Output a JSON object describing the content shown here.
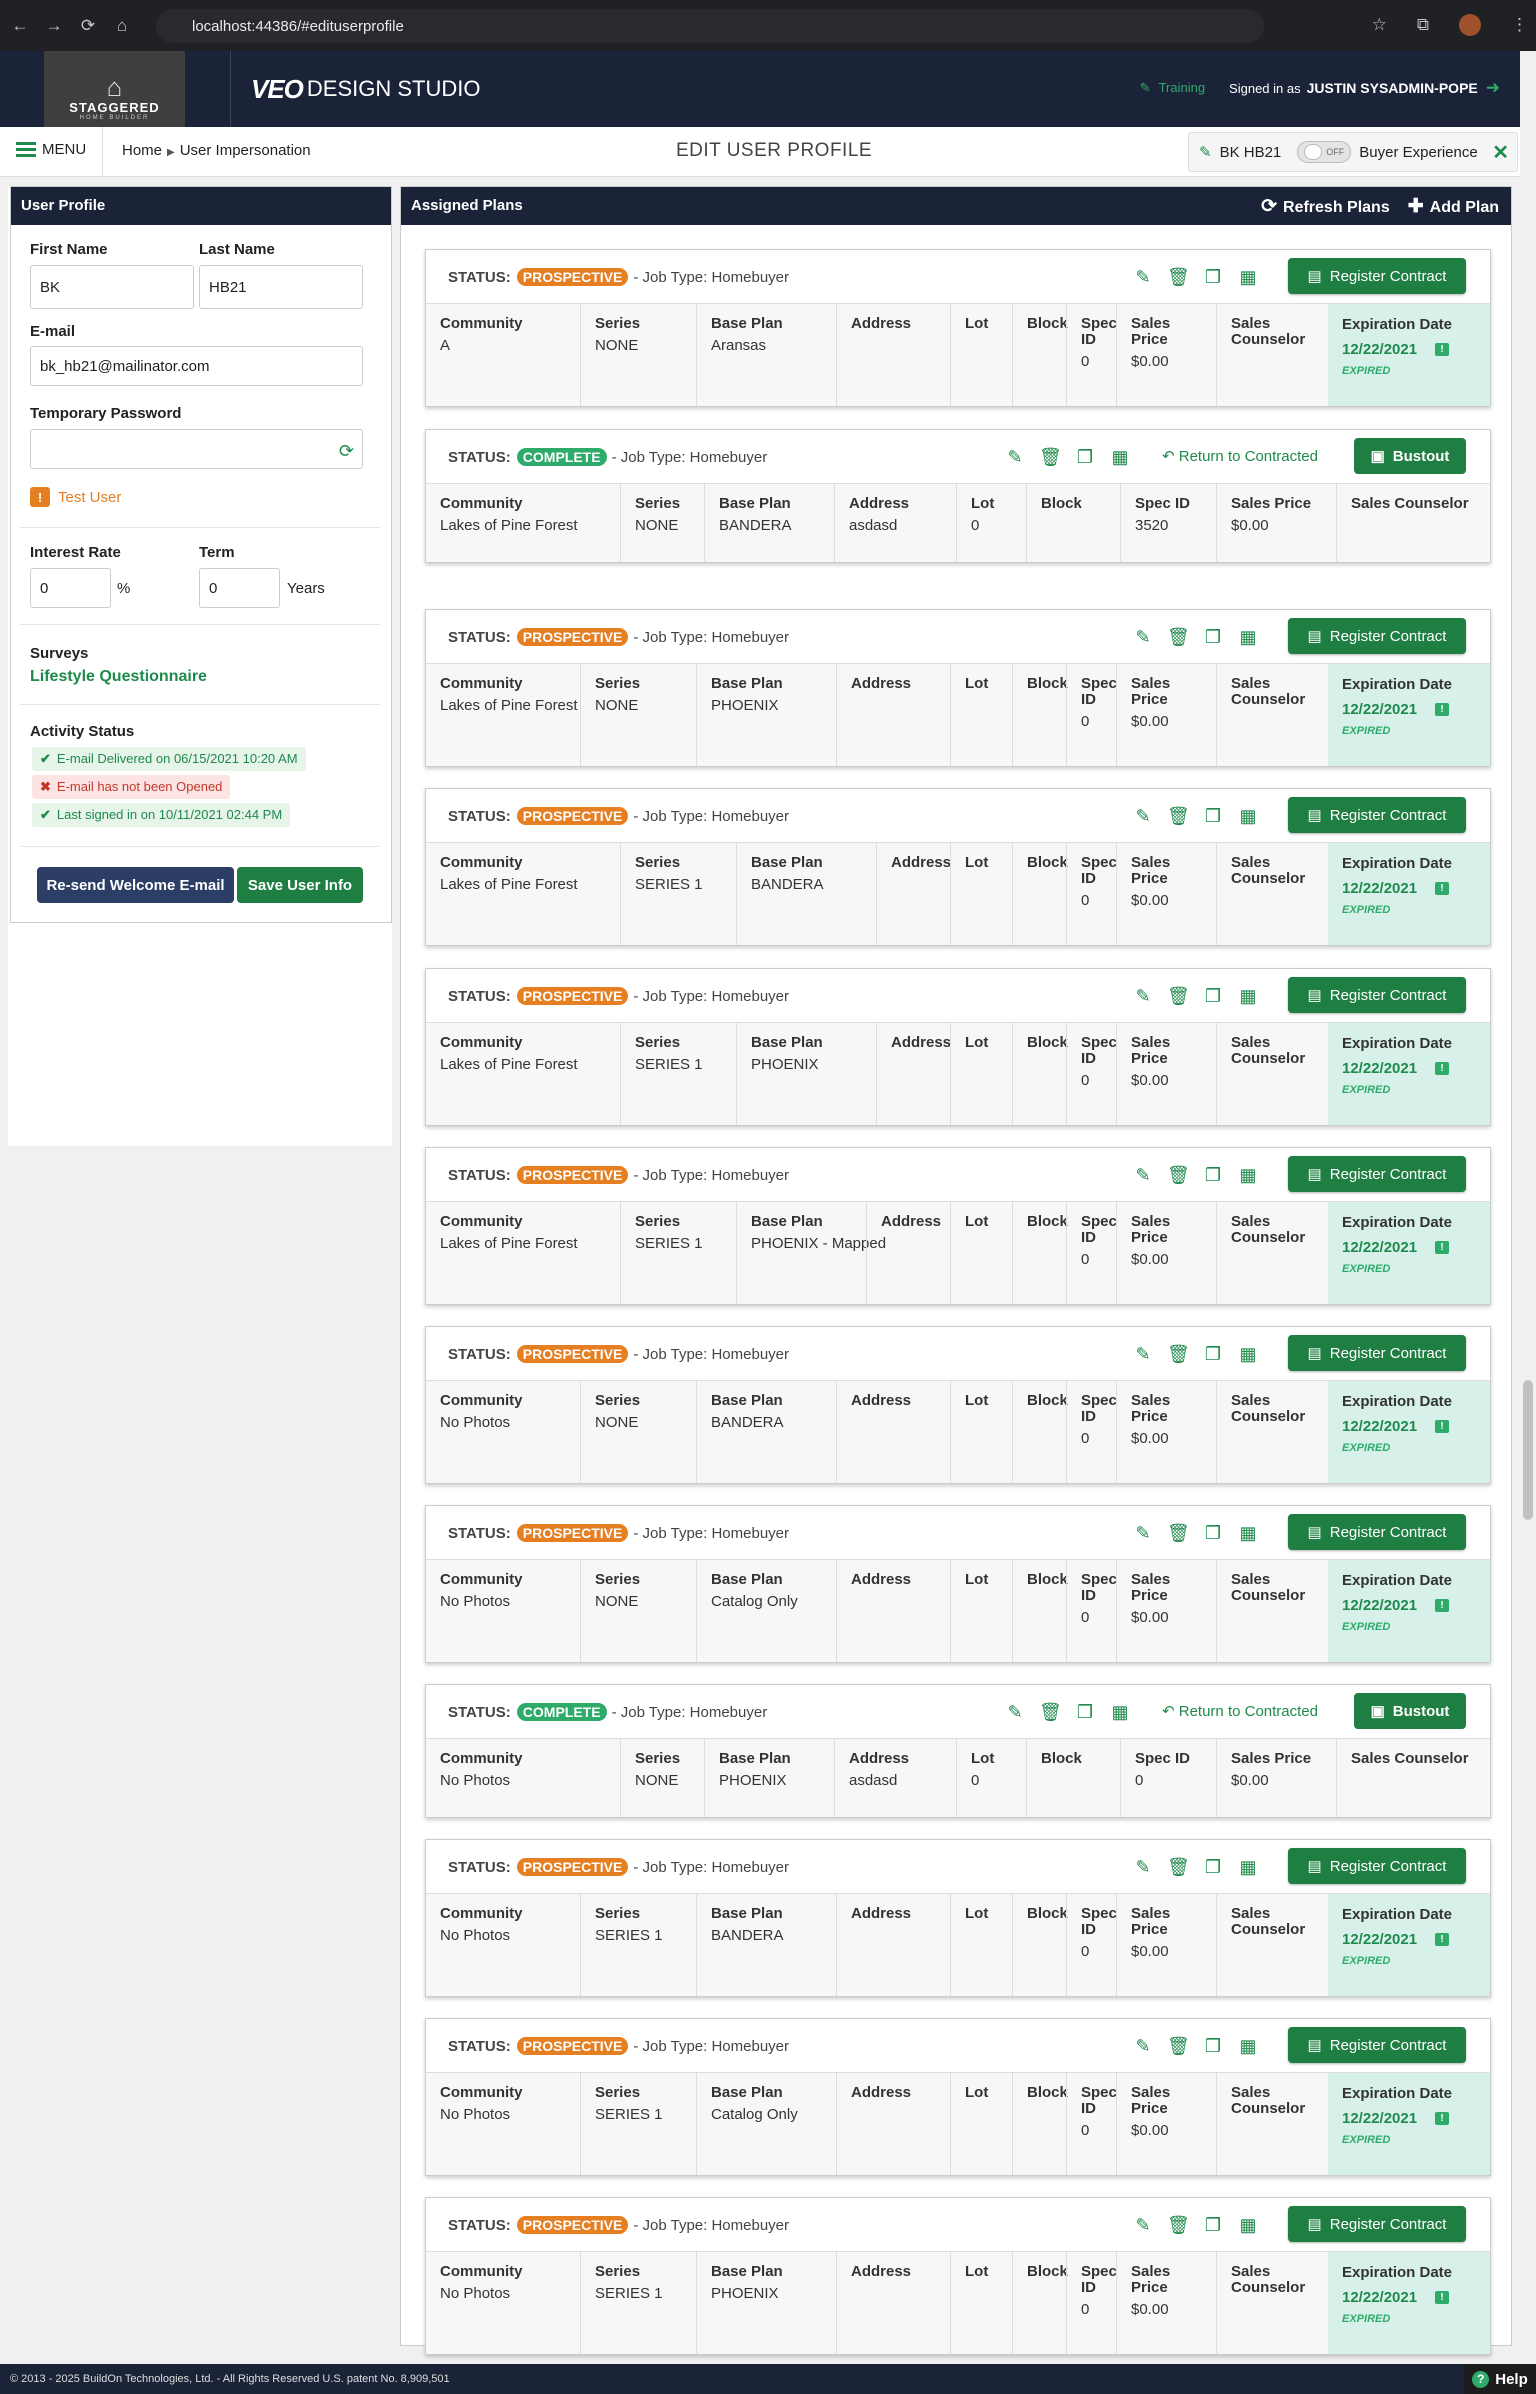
{
  "browser": {
    "url": "localhost:44386/#edituserprofile"
  },
  "brand": {
    "logo_line1": "STAGGERED",
    "logo_line2": "HOME BUILDER",
    "product_main": "VEO",
    "product_sub": "DESIGN STUDIO"
  },
  "header": {
    "training": "Training",
    "signed_in_as": "Signed in as",
    "user": "JUSTIN SYSADMIN-POPE"
  },
  "subbar": {
    "menu": "MENU",
    "crumb_home": "Home",
    "crumb_current": "User Impersonation",
    "title": "EDIT USER PROFILE",
    "impersonated": "BK HB21",
    "toggle": "OFF",
    "buyer_experience": "Buyer Experience"
  },
  "profile": {
    "panel_title": "User Profile",
    "first_name_label": "First Name",
    "first_name": "BK",
    "last_name_label": "Last Name",
    "last_name": "HB21",
    "email_label": "E-mail",
    "email": "bk_hb21@mailinator.com",
    "temp_pw_label": "Temporary Password",
    "temp_pw": "",
    "test_user": "Test User",
    "interest_label": "Interest Rate",
    "interest": "0",
    "interest_unit": "%",
    "term_label": "Term",
    "term": "0",
    "term_unit": "Years",
    "surveys_label": "Surveys",
    "survey_link": "Lifestyle Questionnaire",
    "activity_label": "Activity Status",
    "activity": [
      "E-mail Delivered on 06/15/2021 10:20 AM",
      "E-mail has not been Opened",
      "Last signed in on 10/11/2021 02:44 PM"
    ],
    "resend_btn": "Re-send Welcome E-mail",
    "save_btn": "Save User Info"
  },
  "plans": {
    "panel_title": "Assigned Plans",
    "refresh": "Refresh Plans",
    "add": "Add Plan",
    "status_label": "STATUS:",
    "job_type": "- Job Type: Homebuyer",
    "register": "Register Contract",
    "return": "Return to Contracted",
    "bustout": "Bustout",
    "h_community": "Community",
    "h_series": "Series",
    "h_base": "Base Plan",
    "h_address": "Address",
    "h_lot": "Lot",
    "h_block": "Block",
    "h_spec": "Spec ID",
    "h_price": "Sales Price",
    "h_counselor": "Sales Counselor",
    "h_exp": "Expiration Date",
    "expired": "EXPIRED",
    "items": [
      {
        "status": "PROSPECTIVE",
        "community": "A",
        "series": "NONE",
        "base": "Aransas",
        "address": "",
        "lot": "",
        "block": "",
        "spec": "0",
        "price": "$0.00",
        "exp": "12/22/2021"
      },
      {
        "status": "COMPLETE",
        "community": "Lakes of Pine Forest",
        "series": "NONE",
        "base": "BANDERA",
        "address": "asdasd",
        "lot": "0",
        "block": "",
        "spec": "3520",
        "price": "$0.00"
      },
      {
        "status": "PROSPECTIVE",
        "community": "Lakes of Pine Forest",
        "series": "NONE",
        "base": "PHOENIX",
        "address": "",
        "lot": "",
        "block": "",
        "spec": "0",
        "price": "$0.00",
        "exp": "12/22/2021"
      },
      {
        "status": "PROSPECTIVE",
        "community": "Lakes of Pine Forest",
        "series": "SERIES 1",
        "base": "BANDERA",
        "address": "",
        "lot": "",
        "block": "",
        "spec": "0",
        "price": "$0.00",
        "exp": "12/22/2021"
      },
      {
        "status": "PROSPECTIVE",
        "community": "Lakes of Pine Forest",
        "series": "SERIES 1",
        "base": "PHOENIX",
        "address": "",
        "lot": "",
        "block": "",
        "spec": "0",
        "price": "$0.00",
        "exp": "12/22/2021"
      },
      {
        "status": "PROSPECTIVE",
        "community": "Lakes of Pine Forest",
        "series": "SERIES 1",
        "base": "PHOENIX - Mapped",
        "address": "",
        "lot": "",
        "block": "",
        "spec": "0",
        "price": "$0.00",
        "exp": "12/22/2021"
      },
      {
        "status": "PROSPECTIVE",
        "community": "No Photos",
        "series": "NONE",
        "base": "BANDERA",
        "address": "",
        "lot": "",
        "block": "",
        "spec": "0",
        "price": "$0.00",
        "exp": "12/22/2021"
      },
      {
        "status": "PROSPECTIVE",
        "community": "No Photos",
        "series": "NONE",
        "base": "Catalog Only",
        "address": "",
        "lot": "",
        "block": "",
        "spec": "0",
        "price": "$0.00",
        "exp": "12/22/2021"
      },
      {
        "status": "COMPLETE",
        "community": "No Photos",
        "series": "NONE",
        "base": "PHOENIX",
        "address": "asdasd",
        "lot": "0",
        "block": "",
        "spec": "0",
        "price": "$0.00"
      },
      {
        "status": "PROSPECTIVE",
        "community": "No Photos",
        "series": "SERIES 1",
        "base": "BANDERA",
        "address": "",
        "lot": "",
        "block": "",
        "spec": "0",
        "price": "$0.00",
        "exp": "12/22/2021"
      },
      {
        "status": "PROSPECTIVE",
        "community": "No Photos",
        "series": "SERIES 1",
        "base": "Catalog Only",
        "address": "",
        "lot": "",
        "block": "",
        "spec": "0",
        "price": "$0.00",
        "exp": "12/22/2021"
      },
      {
        "status": "PROSPECTIVE",
        "community": "No Photos",
        "series": "SERIES 1",
        "base": "PHOENIX",
        "address": "",
        "lot": "",
        "block": "",
        "spec": "0",
        "price": "$0.00",
        "exp": "12/22/2021"
      }
    ]
  },
  "footer": {
    "copyright": "© 2013 - 2025 BuildOn Technologies, Ltd. - All Rights Reserved U.S. patent No. 8,909,501",
    "help": "Help"
  },
  "colors": {
    "navy": "#1a2338",
    "green": "#1f7e42",
    "orange": "#e67e22",
    "teal_bg": "#d7f1ea"
  }
}
